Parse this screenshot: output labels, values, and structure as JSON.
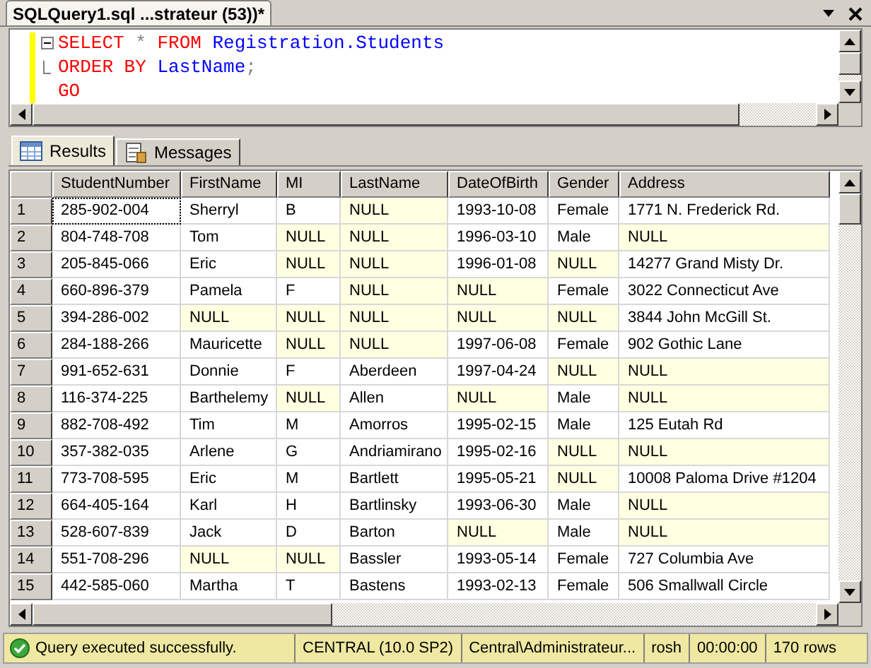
{
  "document_tab": {
    "title": "SQLQuery1.sql ...strateur (53))*"
  },
  "editor": {
    "lines": [
      {
        "kind": "fold_start",
        "tokens": [
          {
            "kind": "keyword",
            "text": "SELECT"
          },
          {
            "kind": "operator",
            "text": " * "
          },
          {
            "kind": "keyword",
            "text": "FROM"
          },
          {
            "kind": "identifier",
            "text": " Registration.Students"
          }
        ]
      },
      {
        "kind": "fold_end",
        "tokens": [
          {
            "kind": "keyword",
            "text": "ORDER BY"
          },
          {
            "kind": "identifier",
            "text": " LastName"
          },
          {
            "kind": "operator",
            "text": ";"
          }
        ]
      },
      {
        "kind": "plain",
        "tokens": [
          {
            "kind": "keyword",
            "text": "GO"
          }
        ]
      }
    ]
  },
  "result_tabs": [
    {
      "label": "Results",
      "selected": true
    },
    {
      "label": "Messages",
      "selected": false
    }
  ],
  "table": {
    "columns": [
      "StudentNumber",
      "FirstName",
      "MI",
      "LastName",
      "DateOfBirth",
      "Gender",
      "Address"
    ],
    "rows": [
      {
        "number": "1",
        "selected": true,
        "cells": [
          "285-902-004",
          "Sherryl",
          "B",
          {
            "v": "NULL",
            "null": true
          },
          "1993-10-08",
          "Female",
          "1771 N. Frederick Rd."
        ]
      },
      {
        "number": "2",
        "selected": false,
        "cells": [
          "804-748-708",
          "Tom",
          {
            "v": "NULL",
            "null": true
          },
          {
            "v": "NULL",
            "null": true
          },
          "1996-03-10",
          "Male",
          {
            "v": "NULL",
            "null": true
          }
        ]
      },
      {
        "number": "3",
        "selected": false,
        "cells": [
          "205-845-066",
          "Eric",
          {
            "v": "NULL",
            "null": true
          },
          {
            "v": "NULL",
            "null": true
          },
          "1996-01-08",
          {
            "v": "NULL",
            "null": true
          },
          "14277 Grand Misty Dr."
        ]
      },
      {
        "number": "4",
        "selected": false,
        "cells": [
          "660-896-379",
          "Pamela",
          "F",
          {
            "v": "NULL",
            "null": true
          },
          {
            "v": "NULL",
            "null": true
          },
          "Female",
          "3022 Connecticut Ave"
        ]
      },
      {
        "number": "5",
        "selected": false,
        "cells": [
          "394-286-002",
          {
            "v": "NULL",
            "null": true
          },
          {
            "v": "NULL",
            "null": true
          },
          {
            "v": "NULL",
            "null": true
          },
          {
            "v": "NULL",
            "null": true
          },
          {
            "v": "NULL",
            "null": true
          },
          "3844 John McGill St."
        ]
      },
      {
        "number": "6",
        "selected": false,
        "cells": [
          "284-188-266",
          "Mauricette",
          {
            "v": "NULL",
            "null": true
          },
          {
            "v": "NULL",
            "null": true
          },
          "1997-06-08",
          "Female",
          "902 Gothic Lane"
        ]
      },
      {
        "number": "7",
        "selected": false,
        "cells": [
          "991-652-631",
          "Donnie",
          "F",
          "Aberdeen",
          "1997-04-24",
          {
            "v": "NULL",
            "null": true
          },
          {
            "v": "NULL",
            "null": true
          }
        ]
      },
      {
        "number": "8",
        "selected": false,
        "cells": [
          "116-374-225",
          "Barthelemy",
          {
            "v": "NULL",
            "null": true
          },
          "Allen",
          {
            "v": "NULL",
            "null": true
          },
          "Male",
          {
            "v": "NULL",
            "null": true
          }
        ]
      },
      {
        "number": "9",
        "selected": false,
        "cells": [
          "882-708-492",
          "Tim",
          "M",
          "Amorros",
          "1995-02-15",
          "Male",
          "125 Eutah Rd"
        ]
      },
      {
        "number": "10",
        "selected": false,
        "cells": [
          "357-382-035",
          "Arlene",
          "G",
          "Andriamirano",
          "1995-02-16",
          {
            "v": "NULL",
            "null": true
          },
          {
            "v": "NULL",
            "null": true
          }
        ]
      },
      {
        "number": "11",
        "selected": false,
        "cells": [
          "773-708-595",
          "Eric",
          "M",
          "Bartlett",
          "1995-05-21",
          {
            "v": "NULL",
            "null": true
          },
          "10008 Paloma Drive #1204"
        ]
      },
      {
        "number": "12",
        "selected": false,
        "cells": [
          "664-405-164",
          "Karl",
          "H",
          "Bartlinsky",
          "1993-06-30",
          "Male",
          {
            "v": "NULL",
            "null": true
          }
        ]
      },
      {
        "number": "13",
        "selected": false,
        "cells": [
          "528-607-839",
          "Jack",
          "D",
          "Barton",
          {
            "v": "NULL",
            "null": true
          },
          "Male",
          {
            "v": "NULL",
            "null": true
          }
        ]
      },
      {
        "number": "14",
        "selected": false,
        "cells": [
          "551-708-296",
          {
            "v": "NULL",
            "null": true
          },
          {
            "v": "NULL",
            "null": true
          },
          "Bassler",
          "1993-05-14",
          "Female",
          "727 Columbia Ave"
        ]
      },
      {
        "number": "15",
        "selected": false,
        "cells": [
          "442-585-060",
          "Martha",
          "T",
          "Bastens",
          "1993-02-13",
          "Female",
          "506 Smallwall Circle"
        ]
      }
    ]
  },
  "status_bar": {
    "message": "Query executed successfully.",
    "server": "CENTRAL (10.0 SP2)",
    "user": "Central\\Administrateur...",
    "database": "rosh",
    "elapsed": "00:00:00",
    "row_count": "170 rows"
  }
}
